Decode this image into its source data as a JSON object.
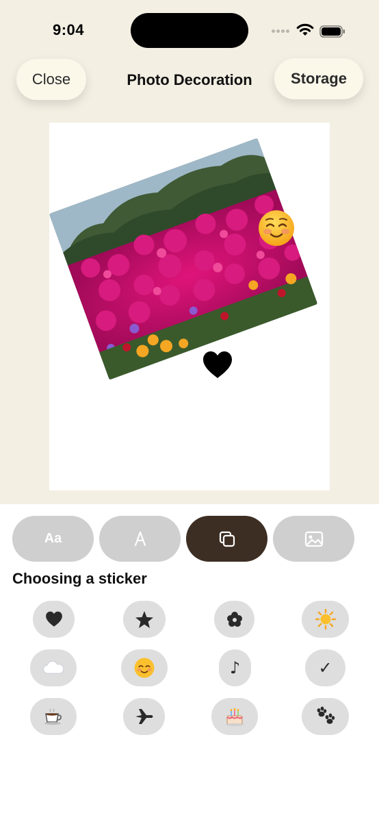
{
  "status_bar": {
    "time": "9:04"
  },
  "header": {
    "close_label": "Close",
    "title": "Photo Decoration",
    "storage_label": "Storage"
  },
  "canvas": {
    "photo_subject": "pink flowers on a hillside",
    "stickers_placed": [
      "smiling-face",
      "heart"
    ],
    "emoji_sticker": "☺️"
  },
  "tools": [
    {
      "name": "text-tool",
      "label": "Aa",
      "active": false
    },
    {
      "name": "drawing-tool",
      "icon": "pen-nib-icon",
      "active": false
    },
    {
      "name": "sticker-tool",
      "icon": "stack-icon",
      "active": true
    },
    {
      "name": "photo-tool",
      "icon": "image-icon",
      "active": false
    }
  ],
  "sticker_panel": {
    "title": "Choosing a sticker",
    "stickers": [
      {
        "name": "heart",
        "glyph": ""
      },
      {
        "name": "star",
        "glyph": ""
      },
      {
        "name": "flower",
        "glyph": "✿"
      },
      {
        "name": "sun",
        "glyph": "☀️"
      },
      {
        "name": "cloud",
        "glyph": "☁️"
      },
      {
        "name": "smiling-face",
        "glyph": "☺️"
      },
      {
        "name": "music-note",
        "glyph": "♪"
      },
      {
        "name": "check",
        "glyph": "✓"
      },
      {
        "name": "coffee",
        "glyph": "☕"
      },
      {
        "name": "airplane",
        "glyph": ""
      },
      {
        "name": "cake",
        "glyph": "🎂"
      },
      {
        "name": "paw",
        "glyph": "🐾"
      }
    ]
  },
  "colors": {
    "background_top": "#f3efe3",
    "button_cream": "#fbf8ea",
    "tool_inactive": "#cfcfcf",
    "tool_active": "#3d2e24",
    "sticker_button": "#dedede"
  }
}
